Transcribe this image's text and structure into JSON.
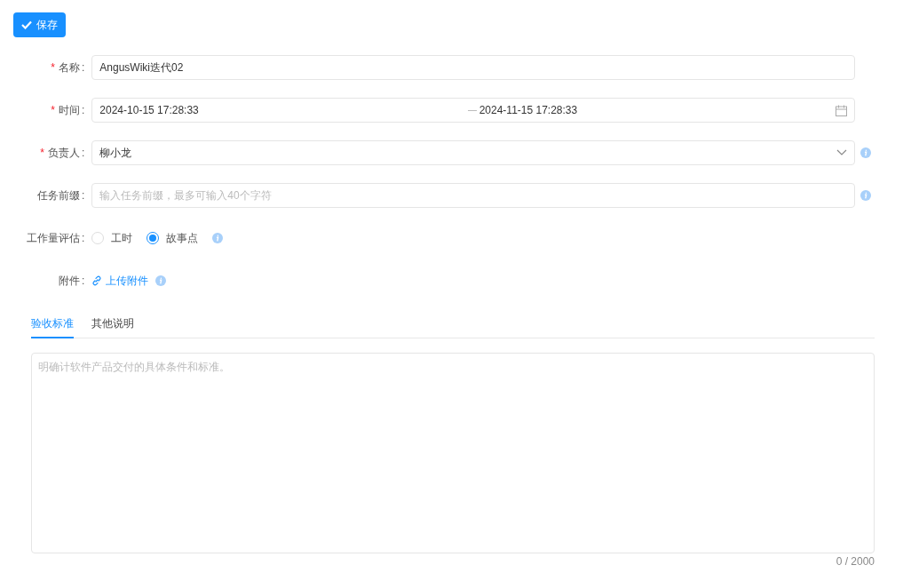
{
  "save_button": {
    "label": "保存"
  },
  "fields": [
    {
      "kind": "text",
      "marker": "*",
      "label": "名称",
      "colon": ":",
      "value": "AngusWiki迭代02",
      "info": false
    },
    {
      "kind": "daterange",
      "marker": "*",
      "label": "时间",
      "colon": ":",
      "start": "2024-10-15 17:28:33",
      "end": "2024-11-15 17:28:33",
      "info": false
    },
    {
      "kind": "select",
      "marker": "*",
      "label": "负责人",
      "colon": ":",
      "value": "柳小龙",
      "info": true
    },
    {
      "kind": "text",
      "label": "任务前缀",
      "colon": ":",
      "placeholder": "输入任务前缀，最多可输入40个字符",
      "info": true
    },
    {
      "kind": "radio",
      "label": "工作量评估",
      "colon": ":",
      "options": [
        {
          "label": "工时",
          "selected": false
        },
        {
          "label": "故事点",
          "selected": true
        }
      ],
      "info": true
    },
    {
      "kind": "upload",
      "label": "附件",
      "colon": ":",
      "link": "上传附件",
      "info": true
    }
  ],
  "tabs": [
    {
      "label": "验收标准",
      "selected": true
    },
    {
      "label": "其他说明",
      "selected": false
    }
  ],
  "textarea": {
    "placeholder": "明确计软件产品交付的具体条件和标准。",
    "count": "0 / 2000"
  }
}
